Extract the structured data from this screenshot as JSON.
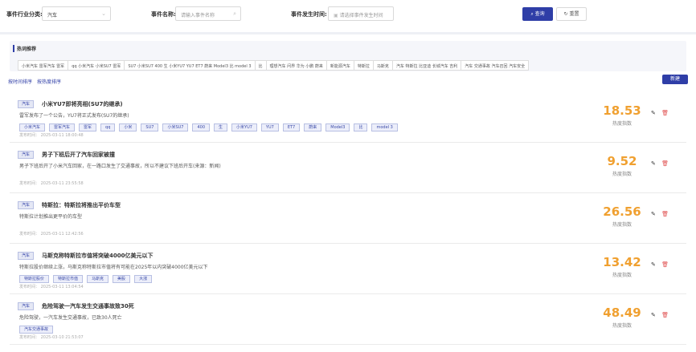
{
  "filters": {
    "industry_label": "事件行业分类:",
    "industry_value": "汽车",
    "name_label": "事件名称:",
    "name_placeholder": "请输入事件名称",
    "time_label": "事件发生时间:",
    "time_placeholder": "请选择事件发生时间",
    "search_label": "查询",
    "more_label": "重置"
  },
  "keywords": {
    "title": "热词推荐",
    "items": [
      "小米汽车  雷军汽车  雷军",
      "qq  小米汽车  小米SU7  雷军",
      "SU7  小米SU7  400  生  小米YU7  YU7  ET7  蔚来  Model3  比  model 3",
      "比",
      "理想汽车  问界  华为  小鹏  蔚来",
      "新能源汽车",
      "特斯拉",
      "马斯克",
      "汽车  特斯拉  比亚迪  长城汽车  吉利",
      "汽车  交通事故  汽车召回  汽车安全"
    ]
  },
  "sort_tabs": [
    "按时间排序",
    "按热度排序"
  ],
  "add_label": "新建",
  "events": [
    {
      "category": "汽车",
      "title": "小米YU7即将亮相(SU7的继承)",
      "summary": "雷军发布了一个公告，YU7将正式发布(SU7的继承)",
      "chips": [
        "小米汽车",
        "雷军汽车",
        "雷军",
        "qq",
        "小米",
        "SU7",
        "小米SU7",
        "400",
        "生",
        "小米YU7",
        "YU7",
        "ET7",
        "蔚来",
        "Model3",
        "比",
        "model 3"
      ],
      "date": "发布时间： 2025-03-11 18:00:48",
      "score": "18.53",
      "score_label": "热度指数"
    },
    {
      "category": "汽车",
      "title": "男子下班后开了汽车回家被撞",
      "summary": "男子下班后开了小米汽车回家，在一路口发生了交通事故，所以不建议下班后开车(来源：新闻)",
      "chips": [],
      "date": "发布时间： 2025-03-11 23:55:58",
      "score": "9.52",
      "score_label": "热度指数"
    },
    {
      "category": "汽车",
      "title": "特斯拉：特斯拉将推出平价车型",
      "summary": "特斯拉计划推出更平价的车型",
      "chips": [],
      "date": "发布时间： 2025-03-11 12:42:56",
      "score": "26.56",
      "score_label": "热度指数"
    },
    {
      "category": "汽车",
      "title": "马斯克称特斯拉市值将突破4000亿美元以下",
      "summary": "特斯拉股价继续上涨，马斯克称特斯拉市值将有可能在2025年以内突破4000亿美元以下",
      "chips": [
        "特斯拉股价",
        "特斯拉市值",
        "马斯克",
        "美股",
        "大涨"
      ],
      "date": "发布时间： 2025-03-11 13:04:54",
      "score": "13.42",
      "score_label": "热度指数"
    },
    {
      "category": "汽车",
      "title": "危险驾驶一汽车发生交通事故致30死",
      "summary": "危险驾驶，一汽车发生交通事故，已致30人死亡",
      "chips": [
        "汽车交通事故"
      ],
      "date": "发布时间： 2025-03-10 21:53:07",
      "score": "48.49",
      "score_label": "热度指数"
    }
  ],
  "colors": {
    "accent": "#2f3ea7",
    "score": "#f0a030",
    "delete": "#e05050"
  }
}
